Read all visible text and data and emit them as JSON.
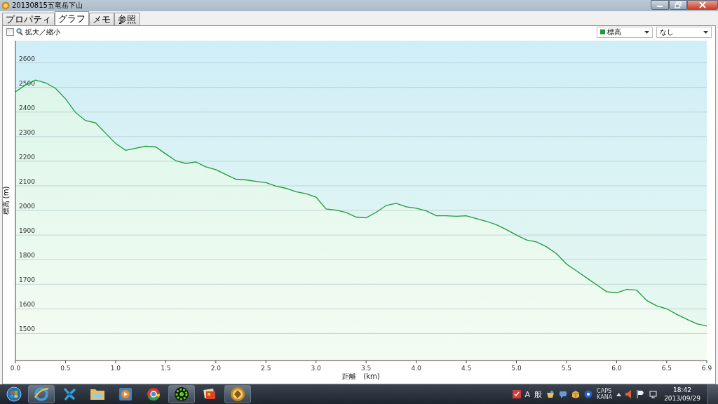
{
  "window": {
    "title": "20130815五竜岳下山"
  },
  "tabs": [
    {
      "label": "プロパティ",
      "selected": false
    },
    {
      "label": "グラフ",
      "selected": true
    },
    {
      "label": "メモ",
      "selected": false
    },
    {
      "label": "参照",
      "selected": false
    }
  ],
  "toolbar": {
    "zoom_checkbox": {
      "label": "拡大／縮小",
      "checked": false
    },
    "second_select": {
      "value": "なし"
    }
  },
  "chart": {
    "chart_data": {
      "type": "area",
      "grid": true,
      "xlabel": "距離　(km)",
      "ylabel": "標高 (m)",
      "xlim": [
        0,
        6.9
      ],
      "ylim": [
        1390,
        2690
      ],
      "xticks": [
        {
          "value": 0,
          "label": "0.0"
        },
        {
          "value": 0.5,
          "label": "0.5"
        },
        {
          "value": 1,
          "label": "1.0"
        },
        {
          "value": 1.5,
          "label": "1.5"
        },
        {
          "value": 2,
          "label": "2.0"
        },
        {
          "value": 2.5,
          "label": "2.5"
        },
        {
          "value": 3,
          "label": "3.0"
        },
        {
          "value": 3.5,
          "label": "3.5"
        },
        {
          "value": 4,
          "label": "4.0"
        },
        {
          "value": 4.5,
          "label": "4.5"
        },
        {
          "value": 5,
          "label": "5.0"
        },
        {
          "value": 5.5,
          "label": "5.5"
        },
        {
          "value": 6,
          "label": "6.0"
        },
        {
          "value": 6.5,
          "label": "6.5"
        },
        {
          "value": 6.9,
          "label": "6.9"
        }
      ],
      "yticks": [
        1500,
        1600,
        1700,
        1800,
        1900,
        2000,
        2100,
        2200,
        2300,
        2400,
        2500,
        2600
      ],
      "x": [
        0,
        0.1,
        0.2,
        0.3,
        0.4,
        0.5,
        0.6,
        0.7,
        0.8,
        0.9,
        1,
        1.1,
        1.2,
        1.3,
        1.4,
        1.5,
        1.6,
        1.7,
        1.8,
        1.9,
        2,
        2.1,
        2.2,
        2.3,
        2.4,
        2.5,
        2.6,
        2.7,
        2.8,
        2.9,
        3,
        3.1,
        3.2,
        3.3,
        3.4,
        3.5,
        3.6,
        3.7,
        3.8,
        3.9,
        4,
        4.1,
        4.2,
        4.3,
        4.4,
        4.5,
        4.6,
        4.7,
        4.8,
        4.9,
        5,
        5.1,
        5.2,
        5.3,
        5.4,
        5.5,
        5.6,
        5.7,
        5.8,
        5.9,
        6,
        6.1,
        6.2,
        6.3,
        6.4,
        6.5,
        6.6,
        6.7,
        6.8,
        6.9
      ],
      "series": [
        {
          "name": "標高",
          "color": "#1e9a3c",
          "values": [
            2482,
            2510,
            2530,
            2519,
            2496,
            2454,
            2398,
            2365,
            2356,
            2314,
            2272,
            2244,
            2253,
            2261,
            2258,
            2230,
            2202,
            2191,
            2197,
            2177,
            2166,
            2146,
            2127,
            2124,
            2118,
            2113,
            2099,
            2090,
            2076,
            2068,
            2054,
            2006,
            2001,
            1992,
            1973,
            1970,
            1992,
            2020,
            2029,
            2015,
            2009,
            1998,
            1978,
            1978,
            1976,
            1978,
            1967,
            1956,
            1942,
            1922,
            1900,
            1880,
            1872,
            1852,
            1824,
            1782,
            1754,
            1726,
            1698,
            1670,
            1665,
            1679,
            1676,
            1634,
            1612,
            1600,
            1578,
            1558,
            1539,
            1530
          ]
        }
      ]
    }
  },
  "taskbar": {
    "apps": [
      {
        "kind": "globe",
        "running": true
      },
      {
        "kind": "fan",
        "running": false
      },
      {
        "kind": "folder",
        "running": false
      },
      {
        "kind": "player",
        "running": false
      },
      {
        "kind": "chrome",
        "running": false
      },
      {
        "kind": "gear",
        "running": true
      },
      {
        "kind": "photos",
        "running": false
      },
      {
        "kind": "app",
        "running": true
      }
    ],
    "ime": [
      "A",
      "般"
    ],
    "locks": [
      "CAPS",
      "KANA"
    ],
    "time": "18:42",
    "date": "2013/09/29"
  }
}
